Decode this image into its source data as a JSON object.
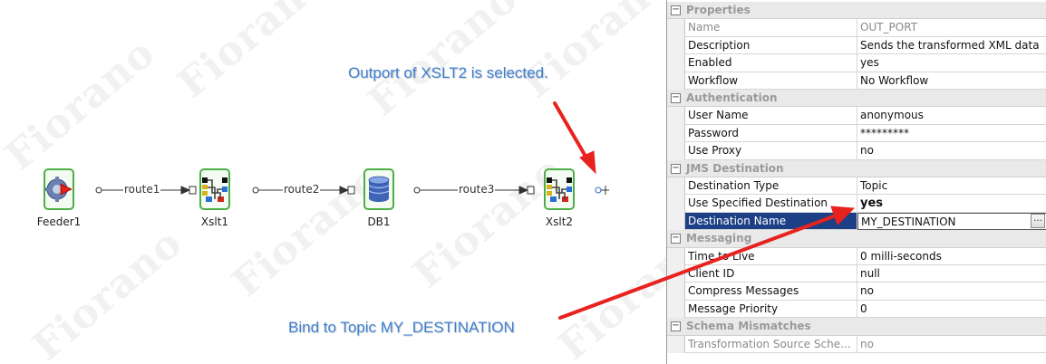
{
  "callouts": {
    "outport_selected": "Outport of XSLT2 is selected.",
    "bind_topic": "Bind to Topic MY_DESTINATION"
  },
  "watermark": "Fiorano",
  "flow": {
    "nodes": [
      {
        "label": "Feeder1",
        "icon": "feeder-gear-icon"
      },
      {
        "label": "Xslt1",
        "icon": "xslt-transform-icon"
      },
      {
        "label": "DB1",
        "icon": "database-icon"
      },
      {
        "label": "Xslt2",
        "icon": "xslt-transform-icon"
      }
    ],
    "routes": [
      "route1",
      "route2",
      "route3"
    ]
  },
  "properties": {
    "sections": [
      {
        "title": "Properties",
        "rows": [
          {
            "name": "Name",
            "value": "OUT_PORT"
          },
          {
            "name": "Description",
            "value": "Sends the transformed XML data"
          },
          {
            "name": "Enabled",
            "value": "yes"
          },
          {
            "name": "Workflow",
            "value": "No Workflow"
          }
        ]
      },
      {
        "title": "Authentication",
        "rows": [
          {
            "name": "User Name",
            "value": "anonymous"
          },
          {
            "name": "Password",
            "value": "*********"
          },
          {
            "name": "Use Proxy",
            "value": "no"
          }
        ]
      },
      {
        "title": "JMS Destination",
        "rows": [
          {
            "name": "Destination Type",
            "value": "Topic"
          },
          {
            "name": "Use Specified Destination",
            "value": "yes"
          },
          {
            "name": "Destination Name",
            "value": "MY_DESTINATION"
          }
        ]
      },
      {
        "title": "Messaging",
        "rows": [
          {
            "name": "Time to Live",
            "value": "0 milli-seconds"
          },
          {
            "name": "Client ID",
            "value": "null"
          },
          {
            "name": "Compress Messages",
            "value": "no"
          },
          {
            "name": "Message Priority",
            "value": "0"
          }
        ]
      },
      {
        "title": "Schema Mismatches",
        "rows": [
          {
            "name": "Transformation Source Sche...",
            "value": "no"
          }
        ]
      }
    ],
    "ellipsis_label": "..."
  },
  "colors": {
    "node_border": "#4cae46",
    "callout_text": "#3f7fd0",
    "arrow": "#e8231f",
    "selection": "#1c3f86"
  }
}
